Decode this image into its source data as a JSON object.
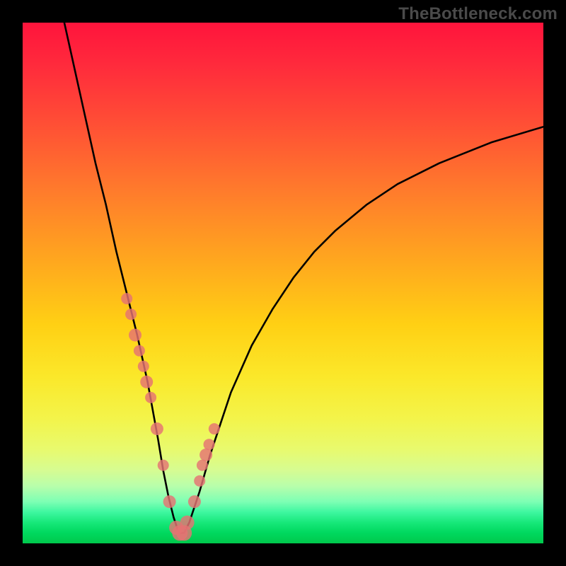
{
  "attribution": "TheBottleneck.com",
  "colors": {
    "background": "#000000",
    "curve": "#000000",
    "dot": "#e57373"
  },
  "chart_data": {
    "type": "line",
    "title": "",
    "xlabel": "",
    "ylabel": "",
    "xlim": [
      0,
      100
    ],
    "ylim": [
      0,
      100
    ],
    "grid": false,
    "legend": false,
    "note": "Values are estimated from pixel geometry; the plot has no visible axis ticks or numeric labels.",
    "series": [
      {
        "name": "bottleneck-curve",
        "x": [
          8,
          10,
          12,
          14,
          16,
          18,
          20,
          22,
          24,
          26,
          27,
          28,
          29,
          30,
          31,
          32,
          34,
          36,
          38,
          40,
          44,
          48,
          52,
          56,
          60,
          66,
          72,
          80,
          90,
          100
        ],
        "y": [
          100,
          91,
          82,
          73,
          65,
          56,
          48,
          40,
          31,
          20,
          14,
          9,
          5,
          2,
          2,
          4,
          10,
          17,
          23,
          29,
          38,
          45,
          51,
          56,
          60,
          65,
          69,
          73,
          77,
          80
        ]
      }
    ],
    "highlighted_points": {
      "name": "measurement-dots",
      "x": [
        20.0,
        20.8,
        21.6,
        22.4,
        23.2,
        23.8,
        24.6,
        25.8,
        27.0,
        28.2,
        29.5,
        30.2,
        31.0,
        31.6,
        33.0,
        34.0,
        34.5,
        35.2,
        35.8,
        36.8
      ],
      "y": [
        47,
        44,
        40,
        37,
        34,
        31,
        28,
        22,
        15,
        8,
        3,
        2,
        2,
        4,
        8,
        12,
        15,
        17,
        19,
        22
      ],
      "r": [
        8,
        8,
        9,
        8,
        8,
        9,
        8,
        9,
        8,
        9,
        10,
        11,
        11,
        10,
        9,
        8,
        8,
        9,
        8,
        8
      ]
    }
  }
}
